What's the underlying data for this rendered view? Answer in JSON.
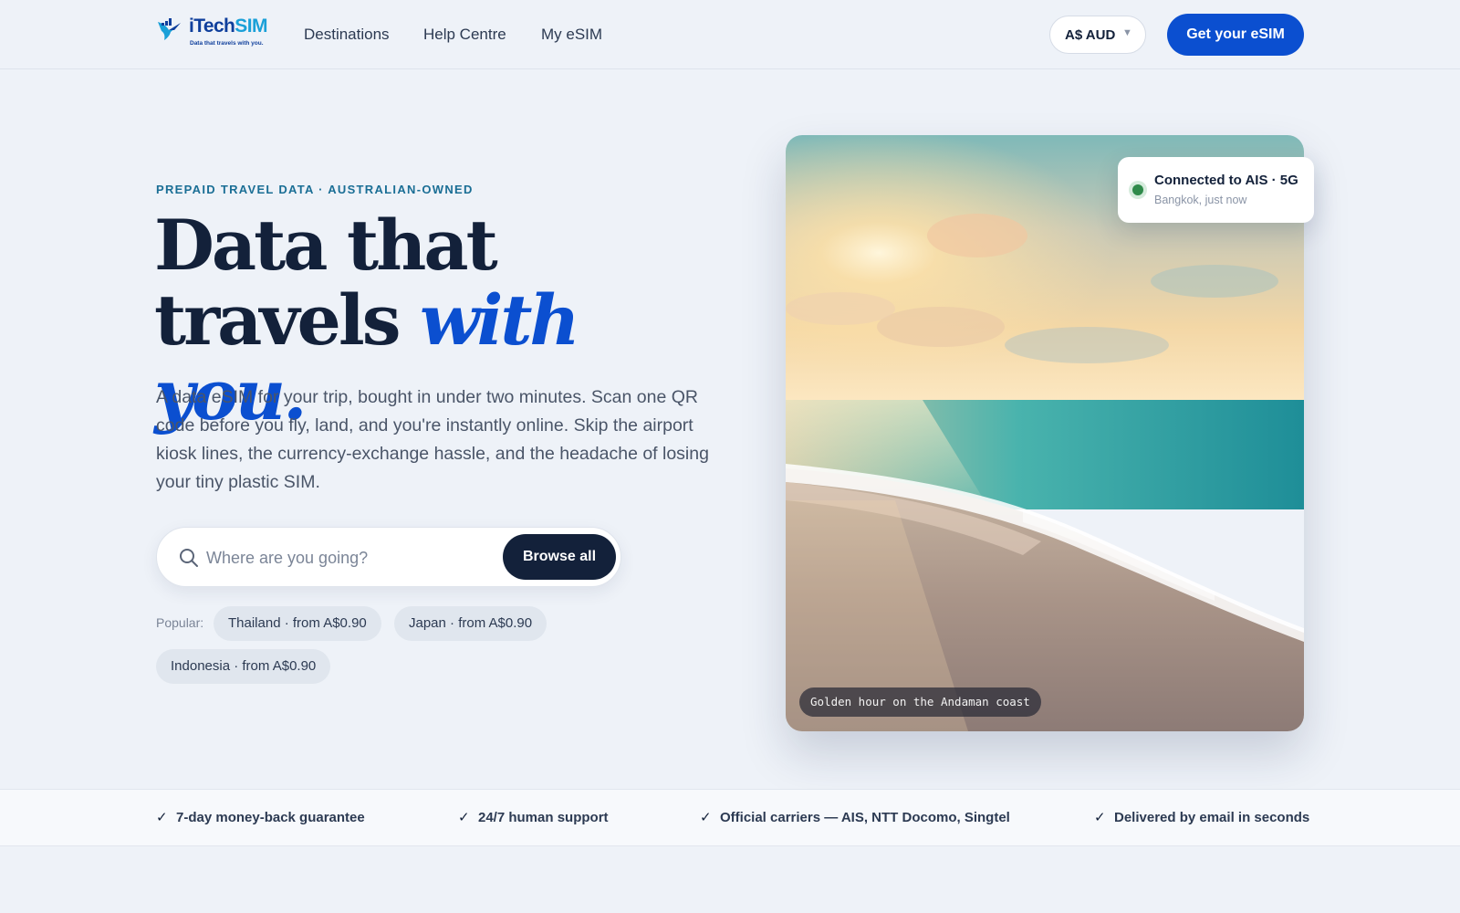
{
  "brand": {
    "name_part1": "iTech",
    "name_part2": "SIM",
    "tagline": "Data that travels with you."
  },
  "nav": {
    "links": [
      "Destinations",
      "Help Centre",
      "My eSIM"
    ]
  },
  "currency": {
    "value": "A$ AUD"
  },
  "header_cta": "Get your eSIM",
  "hero": {
    "eyebrow": "PREPAID TRAVEL DATA · AUSTRALIAN-OWNED",
    "headline_line1": "Data that",
    "headline_line2_plain": "travels ",
    "headline_line2_accent": "with you.",
    "lede": "A data eSIM for your trip, bought in under two minutes. Scan one QR code before you fly, land, and you're instantly online. Skip the airport kiosk lines, the currency-exchange hassle, and the headache of losing your tiny plastic SIM.",
    "search": {
      "placeholder": "Where are you going?",
      "button": "Browse all"
    },
    "popular": {
      "label": "Popular:",
      "chips": [
        "Thailand · from A$0.90",
        "Japan · from A$0.90",
        "Indonesia · from A$0.90"
      ]
    }
  },
  "photo": {
    "caption": "Golden hour on the Andaman coast",
    "status": {
      "title": "Connected to AIS · 5G",
      "subtitle": "Bangkok, just now"
    }
  },
  "trust": [
    "7-day money-back guarantee",
    "24/7 human support",
    "Official carriers — AIS, NTT Docomo, Singtel",
    "Delivered by email in seconds"
  ],
  "colors": {
    "primary": "#0b4fd0",
    "ink": "#13213a",
    "eyebrow": "#1a6e95",
    "background": "#eef2f8",
    "status_online": "#2f8a4a"
  }
}
